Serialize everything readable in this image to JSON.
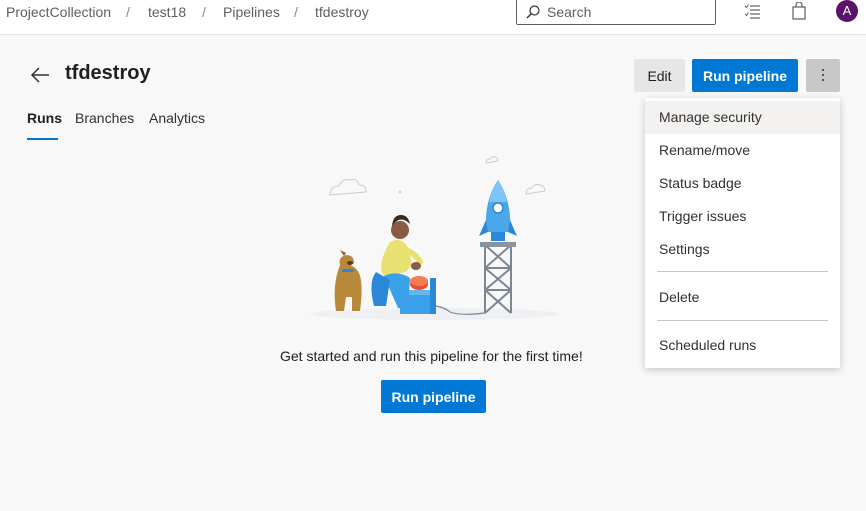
{
  "breadcrumb": {
    "items": [
      "ProjectCollection",
      "test18",
      "Pipelines",
      "tfdestroy"
    ],
    "separator": "/"
  },
  "search": {
    "placeholder": "Search"
  },
  "user": {
    "initial": "A"
  },
  "page": {
    "title": "tfdestroy",
    "edit_label": "Edit",
    "run_label": "Run pipeline"
  },
  "tabs": [
    {
      "label": "Runs",
      "active": true
    },
    {
      "label": "Branches",
      "active": false
    },
    {
      "label": "Analytics",
      "active": false
    }
  ],
  "empty_state": {
    "message": "Get started and run this pipeline for the first time!",
    "button_label": "Run pipeline"
  },
  "menu": {
    "items": [
      {
        "label": "Manage security"
      },
      {
        "label": "Rename/move"
      },
      {
        "label": "Status badge"
      },
      {
        "label": "Trigger issues"
      },
      {
        "label": "Settings"
      },
      {
        "label": "Delete"
      },
      {
        "label": "Scheduled runs"
      }
    ]
  },
  "colors": {
    "accent": "#0078d4",
    "avatar": "#5c126b"
  }
}
